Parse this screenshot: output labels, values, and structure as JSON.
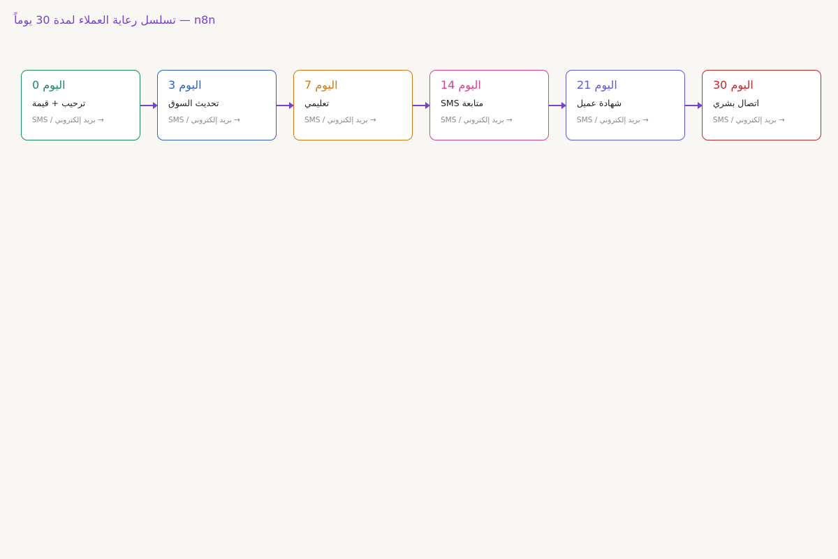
{
  "title": "تسلسل رعاية العملاء لمدة 30 يوماً — n8n",
  "accent_color": "#7a3fd6",
  "channel_label": "SMS / بريد إلكتروني →",
  "steps": [
    {
      "day": "اليوم 0",
      "desc": "ترحيب + قيمة",
      "color": "#1a8a5a"
    },
    {
      "day": "اليوم 3",
      "desc": "تحديث السوق",
      "color": "#2e5fd0"
    },
    {
      "day": "اليوم 7",
      "desc": "تعليمي",
      "color": "#d07a10"
    },
    {
      "day": "اليوم 14",
      "desc": "متابعة SMS",
      "color": "#d8418f"
    },
    {
      "day": "اليوم 21",
      "desc": "شهادة عميل",
      "color": "#5a5ae0"
    },
    {
      "day": "اليوم 30",
      "desc": "اتصال بشري",
      "color": "#c62828"
    }
  ]
}
